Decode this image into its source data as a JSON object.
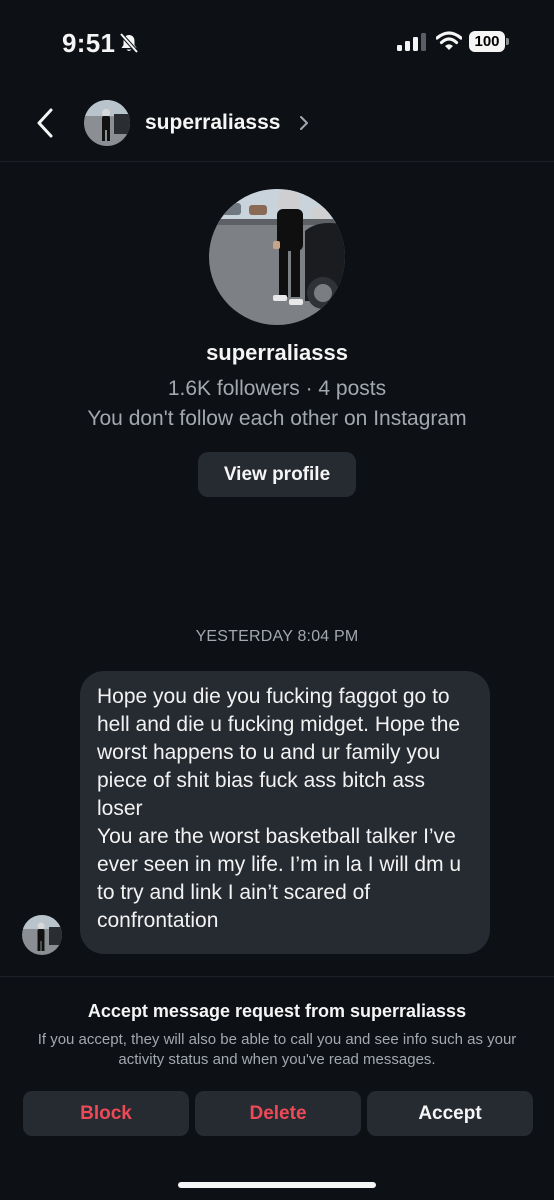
{
  "status_bar": {
    "time": "9:51",
    "battery": "100",
    "icons": [
      "bell-slash-icon",
      "cellular-signal-icon",
      "wifi-icon",
      "battery-icon"
    ]
  },
  "header": {
    "username": "superraliasss",
    "icons": [
      "back-chevron-icon",
      "chevron-right-icon"
    ]
  },
  "profile": {
    "username": "superraliasss",
    "stats": "1.6K followers · 4 posts",
    "follow_status": "You don't follow each other on Instagram",
    "view_profile_label": "View profile"
  },
  "conversation": {
    "timestamp": "YESTERDAY 8:04 PM",
    "message": "Hope you die you fucking faggot go to hell and die u fucking midget. Hope the worst happens to u and ur family you piece of shit bias fuck ass bitch ass loser\nYou are the worst basketball talker I’ve ever seen in my life. I’m in la I will dm u to try and link I ain’t scared of confrontation"
  },
  "request": {
    "title": "Accept message request from superraliasss",
    "description": "If you accept, they will also be able to call you and see info such as your activity status and when you've read messages.",
    "block_label": "Block",
    "delete_label": "Delete",
    "accept_label": "Accept"
  },
  "colors": {
    "background": "#0d1014",
    "surface": "#262a31",
    "secondary_text": "#a3a8ae",
    "destructive": "#ed4956"
  }
}
